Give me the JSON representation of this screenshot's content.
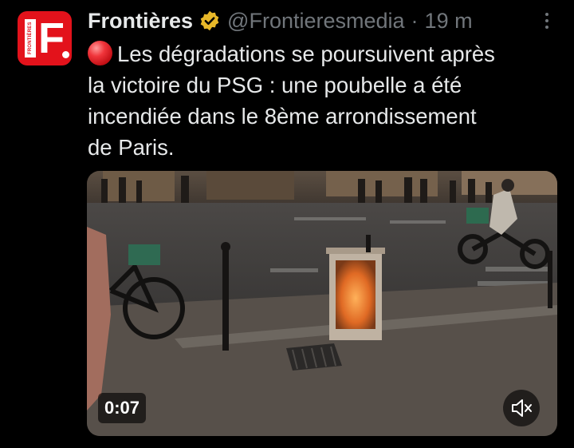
{
  "account": {
    "display_name": "Frontières",
    "handle": "@Frontieresmedia",
    "separator": "·",
    "timestamp": "19 m",
    "avatar_letter": "F",
    "avatar_vertical_text": "FRONTIÈRES",
    "verified_icon": "verified-badge-icon",
    "brand_color": "#e3121b"
  },
  "tweet": {
    "emoji_icon": "red-circle-icon",
    "lines": [
      "Les dégradations se poursuivent après",
      "la victoire du PSG : une poubelle a été",
      "incendiée dans le 8ème arrondissement",
      "de Paris."
    ]
  },
  "media": {
    "duration": "0:07",
    "mute_icon": "volume-muted-icon"
  },
  "colors": {
    "background": "#000000",
    "text": "#e7e9ea",
    "secondary": "#71767b",
    "verified_gold": "#e8b829"
  }
}
